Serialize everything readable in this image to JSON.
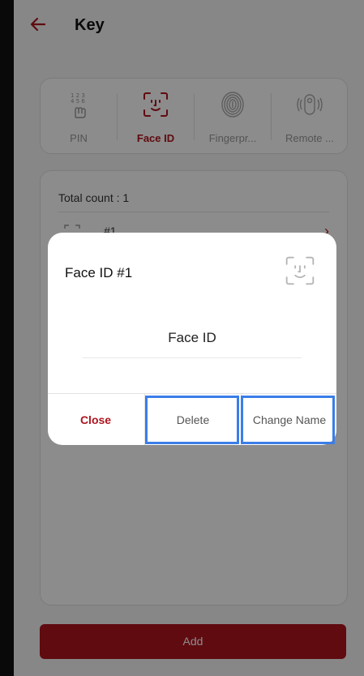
{
  "header": {
    "back_icon": "arrow-left-icon",
    "title": "Key"
  },
  "tabs": [
    {
      "label": "PIN",
      "icon": "keypad-icon",
      "active": false
    },
    {
      "label": "Face ID",
      "icon": "face-id-icon",
      "active": true
    },
    {
      "label": "Fingerpr...",
      "icon": "fingerprint-icon",
      "active": false
    },
    {
      "label": "Remote ...",
      "icon": "remote-icon",
      "active": false
    }
  ],
  "list": {
    "total_label": "Total count : 1",
    "items": [
      {
        "label": "#1",
        "icon": "face-id-icon"
      }
    ]
  },
  "add_button": "Add",
  "dialog": {
    "title": "Face ID #1",
    "icon": "face-id-icon",
    "name_value": "Face ID",
    "buttons": {
      "close": "Close",
      "delete": "Delete",
      "change_name": "Change Name"
    }
  },
  "colors": {
    "accent": "#b0141e",
    "highlight": "#3b7ee8"
  }
}
